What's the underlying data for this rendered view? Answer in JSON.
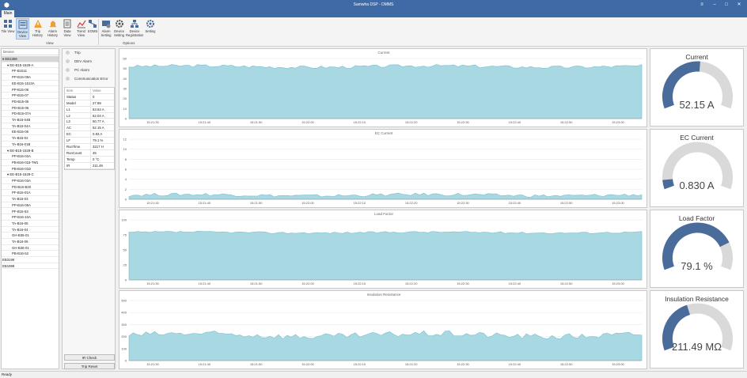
{
  "window": {
    "title": "Samwha DSP - DMMS",
    "minimize": "–",
    "maximize": "□",
    "close": "✕",
    "options": "≡"
  },
  "menu": {
    "tab": "Main"
  },
  "ribbon": {
    "buttons": [
      {
        "label": "Tile View"
      },
      {
        "label": "Device View"
      },
      {
        "label": "Trip History"
      },
      {
        "label": "Alarm History"
      },
      {
        "label": "Data View"
      },
      {
        "label": "Trend View"
      },
      {
        "label": "EOMS"
      },
      {
        "label": "Alarm Setting"
      },
      {
        "label": "Device Setting"
      },
      {
        "label": "Device Registration"
      },
      {
        "label": "Setting"
      }
    ],
    "groups": {
      "view": "View",
      "options": "Options"
    }
  },
  "device_tree": {
    "header": "Device",
    "nodes": [
      {
        "label": "EB1369",
        "level": 0,
        "expanded": true
      },
      {
        "label": "EE-B15-1528-A",
        "level": 1,
        "expanded": true
      },
      {
        "label": "PF-B1511",
        "level": 2
      },
      {
        "label": "PP-B15-09A",
        "level": 2
      },
      {
        "label": "EE-B15-1513A",
        "level": 2
      },
      {
        "label": "PP-B15-08",
        "level": 2
      },
      {
        "label": "PP-B15-07",
        "level": 2
      },
      {
        "label": "PD-B15-05",
        "level": 2
      },
      {
        "label": "PD-B15-06",
        "level": 2
      },
      {
        "label": "PD-B15-07A",
        "level": 2
      },
      {
        "label": "TA-B15-04B",
        "level": 2
      },
      {
        "label": "TA-B15-04A",
        "level": 2
      },
      {
        "label": "EE-B15-06",
        "level": 2
      },
      {
        "label": "TA-B15-02",
        "level": 2
      },
      {
        "label": "TA-B16-01B",
        "level": 2
      },
      {
        "label": "EE-B15-1528-B",
        "level": 1,
        "expanded": true
      },
      {
        "label": "PP-B15-02A",
        "level": 2
      },
      {
        "label": "PB-B16-015-TM1",
        "level": 2
      },
      {
        "label": "PB-B16-01D",
        "level": 2
      },
      {
        "label": "EE-B15-1528-C",
        "level": 1,
        "expanded": true
      },
      {
        "label": "PP-B16-03A",
        "level": 2
      },
      {
        "label": "PD-B16-B20",
        "level": 2
      },
      {
        "label": "PF-B16-01A",
        "level": 2
      },
      {
        "label": "TA-B16-03",
        "level": 2
      },
      {
        "label": "PP-B16-05A",
        "level": 2
      },
      {
        "label": "PF-B16-53",
        "level": 2
      },
      {
        "label": "PP-B16-10A",
        "level": 2
      },
      {
        "label": "TA-B16-05",
        "level": 2
      },
      {
        "label": "TA-B16-04",
        "level": 2
      },
      {
        "label": "GH-B36-01",
        "level": 2
      },
      {
        "label": "TA-B16-06",
        "level": 2
      },
      {
        "label": "GH-B36-01",
        "level": 2
      },
      {
        "label": "PB-B16-52",
        "level": 2
      },
      {
        "label": "EB3199",
        "level": 0
      },
      {
        "label": "EB1999",
        "level": 0
      }
    ]
  },
  "status_indicators": [
    {
      "label": "Trip"
    },
    {
      "label": "DEV Alarm"
    },
    {
      "label": "PC Alarm"
    },
    {
      "label": "Communication Error"
    }
  ],
  "props": {
    "headers": {
      "item": "Item",
      "value": "Value"
    },
    "rows": [
      {
        "item": "Status",
        "value": "0"
      },
      {
        "item": "Model",
        "value": "27.89"
      },
      {
        "item": "L1",
        "value": "53.64 A"
      },
      {
        "item": "L2",
        "value": "52.04 A"
      },
      {
        "item": "L3",
        "value": "50.77 A"
      },
      {
        "item": "AC",
        "value": "52.15 A"
      },
      {
        "item": "EC",
        "value": "0.83 A"
      },
      {
        "item": "LF",
        "value": "79.1 %"
      },
      {
        "item": "RunTime",
        "value": "3217 H"
      },
      {
        "item": "RunCount",
        "value": "45"
      },
      {
        "item": "Temp",
        "value": "0 °C"
      },
      {
        "item": "IR",
        "value": "211.49"
      }
    ],
    "buttons": {
      "ir_check": "IR Check",
      "trip_reset": "Trip Reset"
    }
  },
  "charts": [
    {
      "title": "Current",
      "yticks": [
        "60",
        "50",
        "40",
        "30",
        "20",
        "10",
        "0"
      ],
      "ymax": 60,
      "base": 52,
      "noise": 1.5,
      "xticks": [
        "15:21:30",
        "15:21:40",
        "15:21:50",
        "15:22:00",
        "15:22:10",
        "15:22:20",
        "15:22:30",
        "15:22:40",
        "15:22:50",
        "15:23:00"
      ]
    },
    {
      "title": "EC Current",
      "yticks": [
        "12",
        "10",
        "8",
        "6",
        "4",
        "2",
        "0"
      ],
      "ymax": 12,
      "base": 0.83,
      "noise": 0.3,
      "xticks": [
        "15:21:30",
        "15:21:40",
        "15:21:50",
        "15:22:00",
        "15:22:10",
        "15:22:20",
        "15:22:30",
        "15:22:40",
        "15:22:50",
        "15:23:00"
      ]
    },
    {
      "title": "Load Factor",
      "yticks": [
        "100",
        "75",
        "50",
        "25",
        "0"
      ],
      "ymax": 100,
      "base": 79,
      "noise": 1.5,
      "xticks": [
        "15:21:30",
        "15:21:40",
        "15:21:50",
        "15:22:00",
        "15:22:10",
        "15:22:20",
        "15:22:30",
        "15:22:40",
        "15:22:50",
        "15:23:00"
      ]
    },
    {
      "title": "Insulation Resistance",
      "yticks": [
        "500",
        "400",
        "300",
        "200",
        "100",
        "0"
      ],
      "ymax": 500,
      "base": 212,
      "noise": 25,
      "xticks": [
        "15:21:30",
        "15:21:40",
        "15:21:50",
        "15:22:00",
        "15:22:10",
        "15:22:20",
        "15:22:30",
        "15:22:40",
        "15:22:50",
        "15:23:00"
      ]
    }
  ],
  "gauges": [
    {
      "title": "Current",
      "value_text": "52.15 A",
      "fraction": 0.52
    },
    {
      "title": "EC Current",
      "value_text": "0.830 A",
      "fraction": 0.07
    },
    {
      "title": "Load Factor",
      "value_text": "79.1 %",
      "fraction": 0.791
    },
    {
      "title": "Insulation Resistance",
      "value_text": "211.49 MΩ",
      "fraction": 0.42
    }
  ],
  "colors": {
    "accent": "#3f6aa6",
    "gauge_fill": "#4a6c9b",
    "gauge_bg": "#d9d9d9",
    "chart_fill": "#a8d8e2",
    "chart_line": "#7bbfd0"
  },
  "statusbar": {
    "text": "Ready"
  }
}
